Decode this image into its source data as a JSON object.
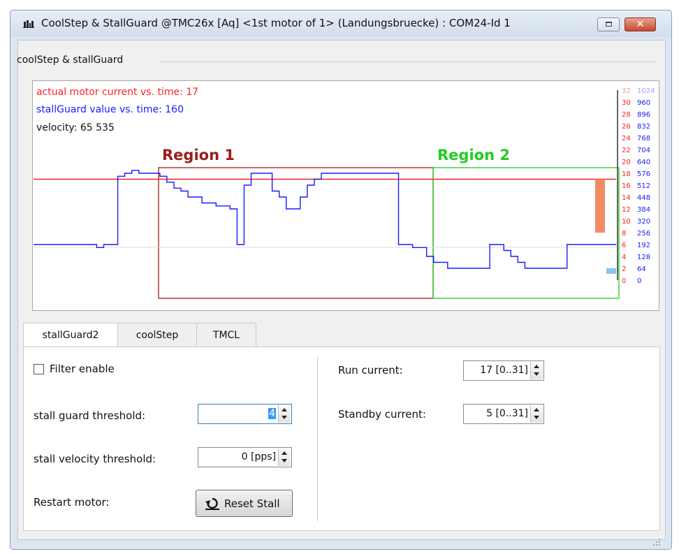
{
  "window": {
    "title": "CoolStep & StallGuard @TMC26x [Aq] <1st motor of 1> (Landungsbruecke) : COM24-Id 1"
  },
  "group": {
    "title": "coolStep & stallGuard"
  },
  "chart": {
    "legend_current": "actual motor current vs. time: 17",
    "legend_stallguard": "stallGuard value vs. time: 160",
    "legend_velocity": "velocity: 65 535",
    "region1_label": "Region 1",
    "region2_label": "Region 2",
    "colors": {
      "current": "#ff2020",
      "stallguard": "#1a1aff",
      "region1": "#9b1c1c",
      "region2": "#22cc22"
    }
  },
  "chart_data": {
    "type": "line",
    "title": "",
    "y_left_ticks": [
      "32",
      "30",
      "28",
      "26",
      "24",
      "22",
      "20",
      "18",
      "16",
      "14",
      "12",
      "10",
      "8",
      "6",
      "4",
      "2",
      "0"
    ],
    "y_right_ticks": [
      "1024",
      "960",
      "896",
      "832",
      "768",
      "704",
      "640",
      "576",
      "512",
      "448",
      "384",
      "320",
      "256",
      "192",
      "128",
      "64",
      "0"
    ],
    "ylim_current": [
      0,
      32
    ],
    "ylim_stallguard": [
      0,
      1024
    ],
    "series": [
      {
        "name": "actual motor current vs. time",
        "color": "#ff2020",
        "values_description": "constant",
        "values": [
          17
        ]
      },
      {
        "name": "stallGuard value vs. time",
        "color": "#1a1aff",
        "values": [
          192,
          192,
          192,
          192,
          192,
          192,
          192,
          192,
          192,
          176,
          192,
          192,
          560,
          576,
          592,
          576,
          576,
          576,
          560,
          528,
          496,
          480,
          448,
          448,
          416,
          416,
          400,
          400,
          384,
          192,
          512,
          576,
          576,
          576,
          480,
          448,
          384,
          384,
          448,
          512,
          544,
          576,
          576,
          576,
          576,
          576,
          576,
          576,
          576,
          576,
          576,
          576,
          192,
          192,
          176,
          176,
          128,
          96,
          96,
          64,
          64,
          64,
          64,
          64,
          64,
          192,
          192,
          160,
          128,
          96,
          64,
          64,
          64,
          64,
          64,
          64,
          192,
          192,
          192,
          192,
          192,
          192,
          192
        ]
      }
    ],
    "bars": [
      {
        "axis": "current",
        "value": 17,
        "color": "#f28b64"
      },
      {
        "axis": "stallguard",
        "value": 64,
        "color": "#87c7f0"
      }
    ]
  },
  "tabs": [
    {
      "label": "stallGuard2",
      "active": true
    },
    {
      "label": "coolStep",
      "active": false
    },
    {
      "label": "TMCL",
      "active": false
    }
  ],
  "left_panel": {
    "filter_label": "Filter enable",
    "filter_checked": false,
    "sg_threshold_label": "stall guard threshold:",
    "sg_threshold_value": "4",
    "stall_velocity_label": "stall velocity threshold:",
    "stall_velocity_value": "0 [pps]",
    "restart_label": "Restart motor:",
    "reset_button_label": "Reset Stall"
  },
  "right_panel": {
    "run_current_label": "Run current:",
    "run_current_value": "17 [0..31]",
    "standby_current_label": "Standby current:",
    "standby_current_value": "5 [0..31]"
  }
}
